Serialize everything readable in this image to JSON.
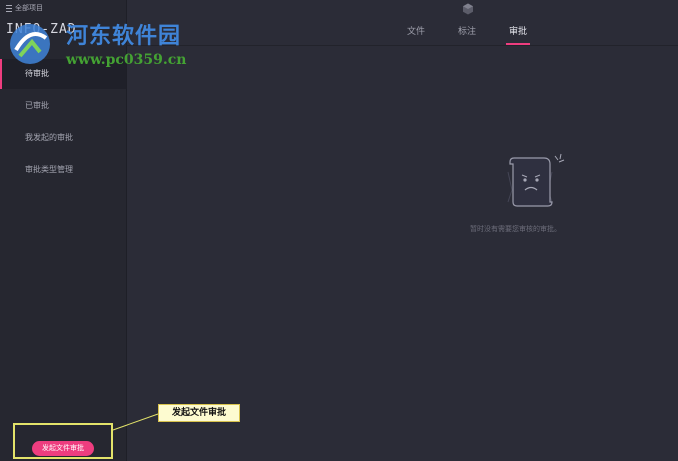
{
  "sidebar": {
    "all_projects": "全部项目",
    "project_name": "INFO-ZAD",
    "items": [
      {
        "label": "待审批"
      },
      {
        "label": "已审批"
      },
      {
        "label": "我发起的审批"
      },
      {
        "label": "审批类型管理"
      }
    ],
    "start_button": "发起文件审批"
  },
  "tabs": [
    {
      "label": "文件"
    },
    {
      "label": "标注"
    },
    {
      "label": "审批"
    }
  ],
  "active_tab": "审批",
  "empty_state": {
    "message": "暂时没有需要您审核的审批。",
    "icon": "sad-document-icon"
  },
  "callout": {
    "label": "发起文件审批"
  },
  "watermark": {
    "title": "河东软件园",
    "url": "www.pc0359.cn"
  },
  "colors": {
    "accent": "#ee3d7f",
    "background": "#2b2c37",
    "sidebar": "#262730"
  }
}
